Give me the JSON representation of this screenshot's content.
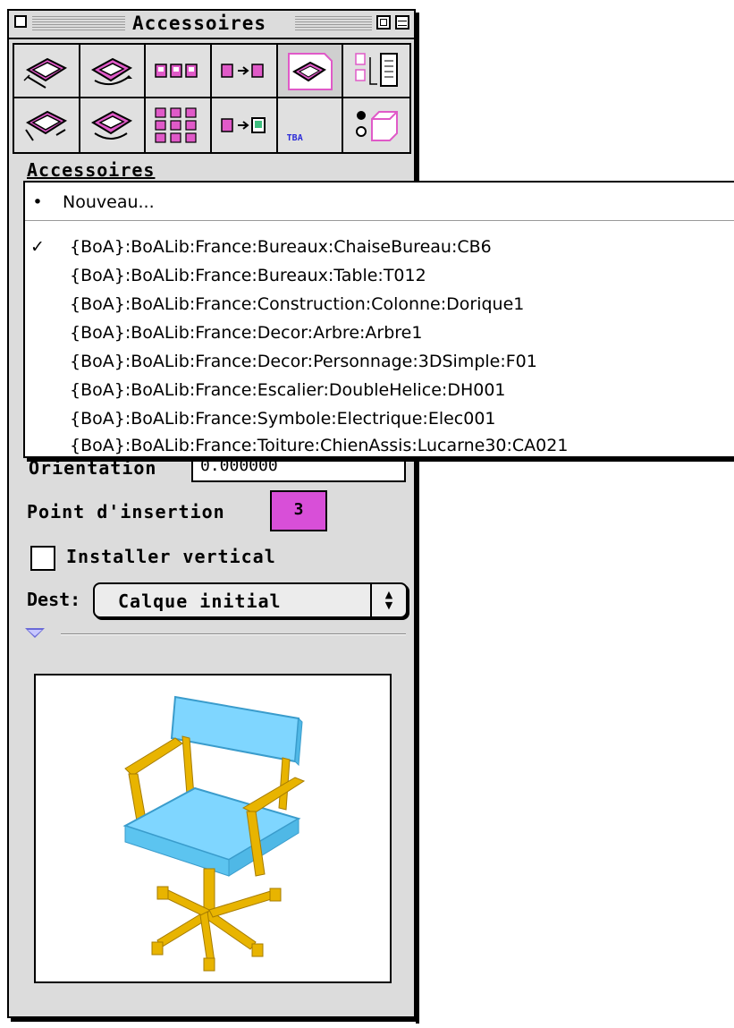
{
  "palette": {
    "title": "Accessoires",
    "section_label": "Accessoires",
    "tba_label": "TBA",
    "orientation_label": "Orientation",
    "orientation_value": "0.000000",
    "insertion_label": "Point d'insertion",
    "insertion_value": "3",
    "insertion_color": "#d84fd8",
    "install_vertical_label": "Installer vertical",
    "install_vertical_checked": false,
    "dest_label": "Dest:",
    "dest_value": "Calque initial"
  },
  "tools": [
    {
      "icon": "wall-object-icon",
      "selected": false
    },
    {
      "icon": "rotate-object-icon",
      "selected": false
    },
    {
      "icon": "object-row-icon",
      "selected": false
    },
    {
      "icon": "object-to-object-icon",
      "selected": false
    },
    {
      "icon": "object-on-page-icon",
      "selected": true
    },
    {
      "icon": "object-list-icon",
      "selected": false
    },
    {
      "icon": "wall-object-alt-icon",
      "selected": false
    },
    {
      "icon": "rotate-object-alt-icon",
      "selected": false
    },
    {
      "icon": "object-grid-icon",
      "selected": false
    },
    {
      "icon": "object-to-image-icon",
      "selected": false
    },
    {
      "icon": "tba-icon",
      "selected": false
    },
    {
      "icon": "object-cube-icon",
      "selected": false
    }
  ],
  "menu": {
    "new_item": "Nouveau...",
    "new_marker": "•",
    "items": [
      {
        "label": "{BoA}:BoALib:France:Bureaux:ChaiseBureau:CB6",
        "checked": true
      },
      {
        "label": "{BoA}:BoALib:France:Bureaux:Table:T012",
        "checked": false
      },
      {
        "label": "{BoA}:BoALib:France:Construction:Colonne:Dorique1",
        "checked": false
      },
      {
        "label": "{BoA}:BoALib:France:Decor:Arbre:Arbre1",
        "checked": false
      },
      {
        "label": "{BoA}:BoALib:France:Decor:Personnage:3DSimple:F01",
        "checked": false
      },
      {
        "label": "{BoA}:BoALib:France:Escalier:DoubleHelice:DH001",
        "checked": false
      },
      {
        "label": "{BoA}:BoALib:France:Symbole:Electrique:Elec001",
        "checked": false
      },
      {
        "label": "{BoA}:BoALib:France:Toiture:ChienAssis:Lucarne30:CA021",
        "checked": false
      }
    ],
    "check_mark": "✓"
  },
  "preview": {
    "subject": "office-chair-icon",
    "seat_color": "#7fd6ff",
    "frame_color": "#e8b400"
  }
}
